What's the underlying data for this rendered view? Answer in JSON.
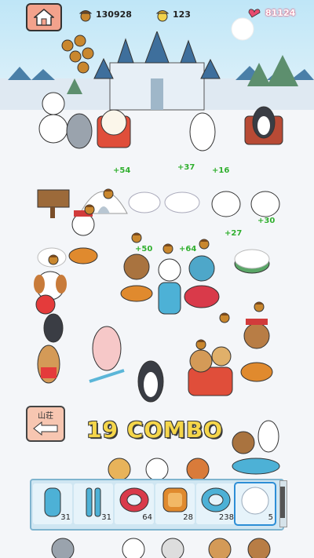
{
  "hud": {
    "acorns_total": "130928",
    "golden_acorns": "123",
    "hearts": "81124"
  },
  "combo": "19 COMBO",
  "sanso_button": {
    "label": "山荘"
  },
  "score_popups": [
    "+54",
    "+37",
    "+16",
    "+27",
    "+30",
    "+50",
    "+64"
  ],
  "toolbar": {
    "items": [
      {
        "icon": "blue-sled-icon",
        "count": "31"
      },
      {
        "icon": "twin-skis-icon",
        "count": "31"
      },
      {
        "icon": "red-tube-icon",
        "count": "64"
      },
      {
        "icon": "wooden-sled-icon",
        "count": "28"
      },
      {
        "icon": "blue-tube-icon",
        "count": "238"
      },
      {
        "icon": "snowball-icon",
        "count": "5"
      }
    ]
  },
  "colors": {
    "combo": "#f5d64a",
    "score": "#2fae2f",
    "home_button": "#f3a28c",
    "toolbar": "#cfe6f2"
  }
}
